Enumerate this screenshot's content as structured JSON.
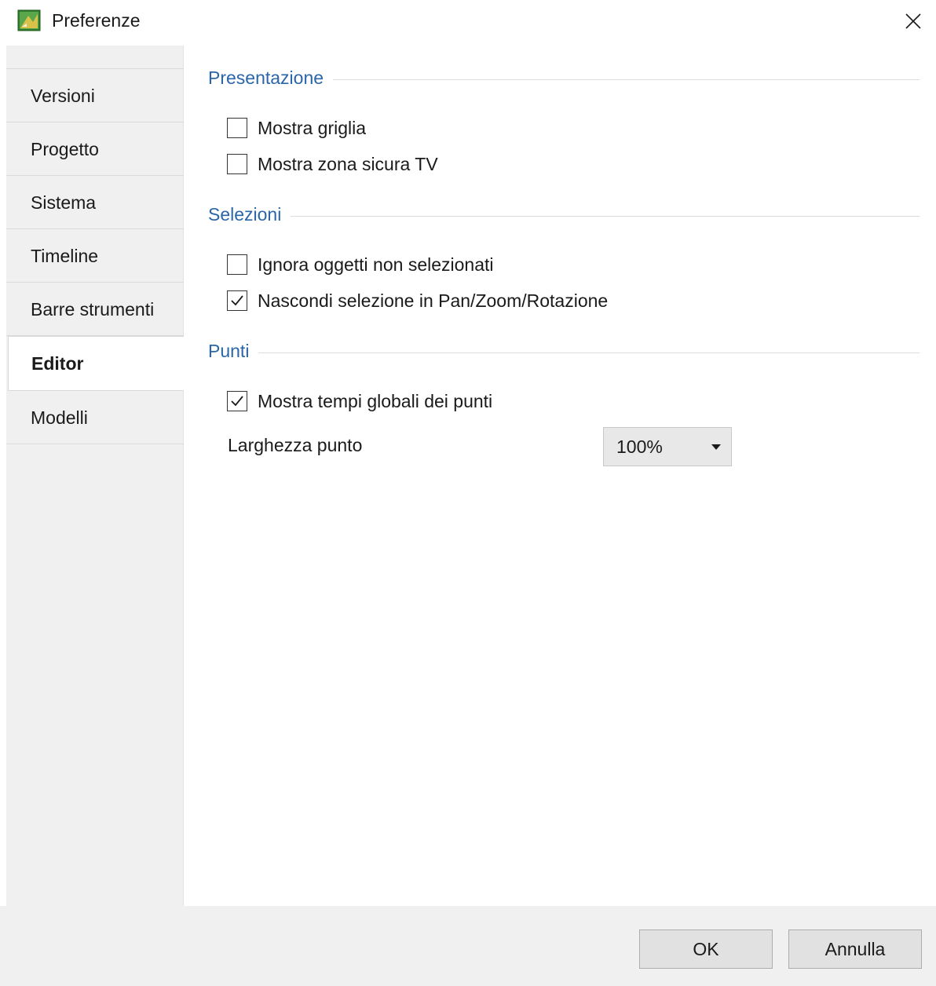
{
  "window": {
    "title": "Preferenze",
    "icon": "app-icon",
    "close_icon": "close-icon"
  },
  "sidebar": {
    "items": [
      {
        "label": "Versioni",
        "active": false
      },
      {
        "label": "Progetto",
        "active": false
      },
      {
        "label": "Sistema",
        "active": false
      },
      {
        "label": "Timeline",
        "active": false
      },
      {
        "label": "Barre strumenti",
        "active": false
      },
      {
        "label": "Editor",
        "active": true
      },
      {
        "label": "Modelli",
        "active": false
      }
    ]
  },
  "content": {
    "groups": [
      {
        "title": "Presentazione",
        "options": [
          {
            "label": "Mostra griglia",
            "checked": false
          },
          {
            "label": "Mostra zona sicura TV",
            "checked": false
          }
        ]
      },
      {
        "title": "Selezioni",
        "options": [
          {
            "label": "Ignora oggetti non selezionati",
            "checked": false
          },
          {
            "label": "Nascondi selezione in Pan/Zoom/Rotazione",
            "checked": true
          }
        ]
      },
      {
        "title": "Punti",
        "options": [
          {
            "label": "Mostra tempi globali dei punti",
            "checked": true
          }
        ],
        "field": {
          "label": "Larghezza punto",
          "value": "100%"
        }
      }
    ]
  },
  "footer": {
    "ok_label": "OK",
    "cancel_label": "Annulla"
  },
  "colors": {
    "group_title": "#2a66a8",
    "sidebar_bg": "#f0f0f0",
    "footer_bg": "#f0f0f0",
    "button_bg": "#e1e1e1"
  }
}
